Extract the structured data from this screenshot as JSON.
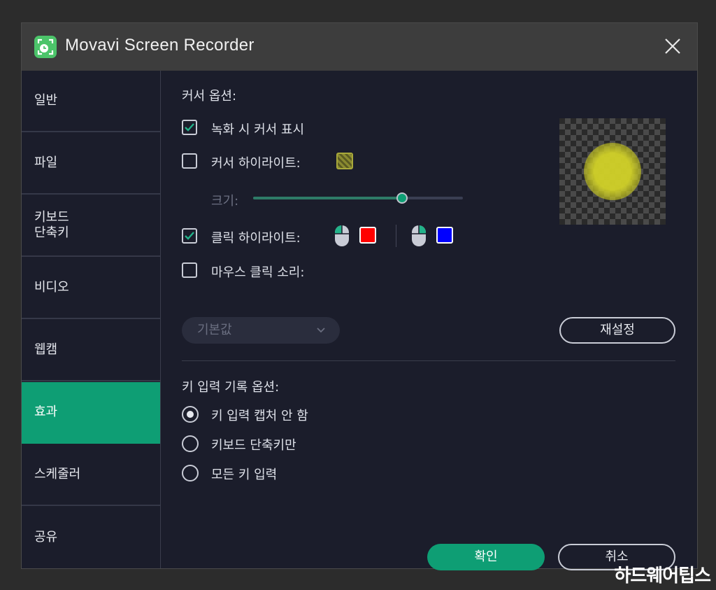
{
  "window": {
    "title": "Movavi Screen Recorder"
  },
  "sidebar": {
    "items": [
      {
        "label": "일반"
      },
      {
        "label": "파일"
      },
      {
        "label": "키보드\n단축키"
      },
      {
        "label": "비디오"
      },
      {
        "label": "웹캠"
      },
      {
        "label": "효과"
      },
      {
        "label": "스케줄러"
      },
      {
        "label": "공유"
      }
    ],
    "active_index": 5
  },
  "cursor_options": {
    "heading": "커서 옵션:",
    "show_cursor": {
      "label": "녹화 시 커서 표시",
      "checked": true
    },
    "cursor_highlight": {
      "label": "커서 하이라이트:",
      "checked": false,
      "color": "#9a9a30"
    },
    "size": {
      "label": "크기:",
      "value_fraction": 0.71
    },
    "click_highlight": {
      "label": "클릭 하이라이트:",
      "checked": true,
      "left_click_color": "#ff0000",
      "right_click_color": "#0000ff"
    },
    "mouse_click_sound": {
      "label": "마우스 클릭 소리:",
      "checked": false
    },
    "sound_dropdown": {
      "selected": "기본값"
    },
    "reset_button": "재설정"
  },
  "key_options": {
    "heading": "키 입력 기록 옵션:",
    "choices": [
      {
        "label": "키 입력 캡처 안 함",
        "selected": true
      },
      {
        "label": "키보드 단축키만",
        "selected": false
      },
      {
        "label": "모든 키 입력",
        "selected": false
      }
    ]
  },
  "footer": {
    "ok": "확인",
    "cancel": "취소"
  },
  "watermark": "하드웨어팁스",
  "colors": {
    "accent": "#0e9e74",
    "background": "#1b1d2b",
    "titlebar": "#3d3d3d"
  }
}
